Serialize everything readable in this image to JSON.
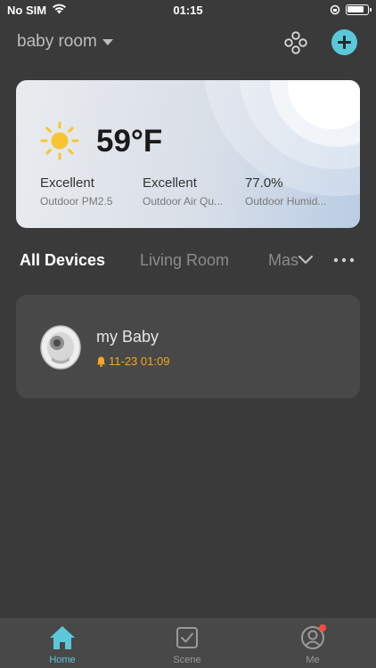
{
  "status_bar": {
    "carrier": "No SIM",
    "time": "01:15"
  },
  "header": {
    "home_name": "baby room"
  },
  "weather": {
    "temperature": "59°F",
    "metrics": [
      {
        "value": "Excellent",
        "label": "Outdoor PM2.5"
      },
      {
        "value": "Excellent",
        "label": "Outdoor Air Qu..."
      },
      {
        "value": "77.0%",
        "label": "Outdoor Humid..."
      }
    ]
  },
  "tabs": [
    {
      "label": "All Devices",
      "active": true
    },
    {
      "label": "Living Room",
      "active": false
    },
    {
      "label": "Mas",
      "active": false
    }
  ],
  "devices": [
    {
      "name": "my Baby",
      "status": "11-23 01:09"
    }
  ],
  "bottom_nav": [
    {
      "label": "Home",
      "active": true
    },
    {
      "label": "Scene",
      "active": false
    },
    {
      "label": "Me",
      "active": false
    }
  ],
  "colors": {
    "background": "#3a3a3a",
    "accent": "#5bc8d9",
    "alert": "#f5a623",
    "notification": "#ff4b3e"
  }
}
